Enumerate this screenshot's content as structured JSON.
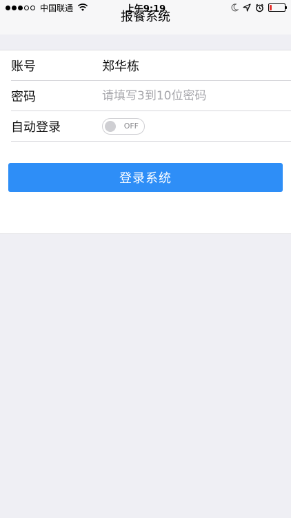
{
  "status_bar": {
    "carrier": "中国联通",
    "time": "上午9:19",
    "signal_bars": 3,
    "battery_level": 0.15,
    "battery_color": "#e5322d"
  },
  "nav": {
    "title": "报餐系统"
  },
  "form": {
    "account_label": "账号",
    "account_value": "郑华栋",
    "password_label": "密码",
    "password_placeholder": "请填写3到10位密码",
    "auto_login_label": "自动登录",
    "auto_login_state": "OFF"
  },
  "login_button": {
    "label": "登录系统",
    "color": "#2e8ef7"
  }
}
